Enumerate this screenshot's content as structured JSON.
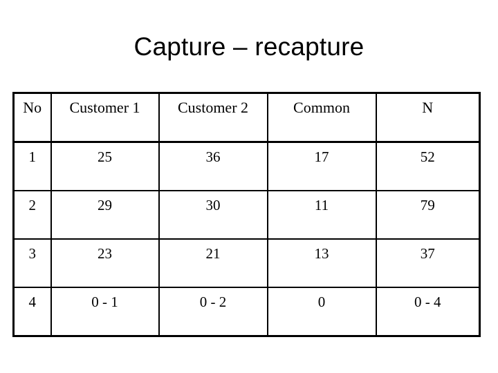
{
  "slide": {
    "title": "Capture – recapture"
  },
  "table": {
    "columns": [
      {
        "key": "no",
        "label": "No"
      },
      {
        "key": "customer1",
        "label": "Customer 1"
      },
      {
        "key": "customer2",
        "label": "Customer 2"
      },
      {
        "key": "common",
        "label": "Common"
      },
      {
        "key": "n",
        "label": "N"
      }
    ],
    "rows": [
      {
        "no": "1",
        "customer1": "25",
        "customer2": "36",
        "common": "17",
        "n": "52"
      },
      {
        "no": "2",
        "customer1": "29",
        "customer2": "30",
        "common": "11",
        "n": "79"
      },
      {
        "no": "3",
        "customer1": "23",
        "customer2": "21",
        "common": "13",
        "n": "37"
      },
      {
        "no": "4",
        "customer1": "0 - 1",
        "customer2": "0 - 2",
        "common": "0",
        "n": "0 - 4"
      }
    ]
  },
  "colors": {
    "background": "#ffffff",
    "text": "#000000",
    "border": "#000000"
  }
}
